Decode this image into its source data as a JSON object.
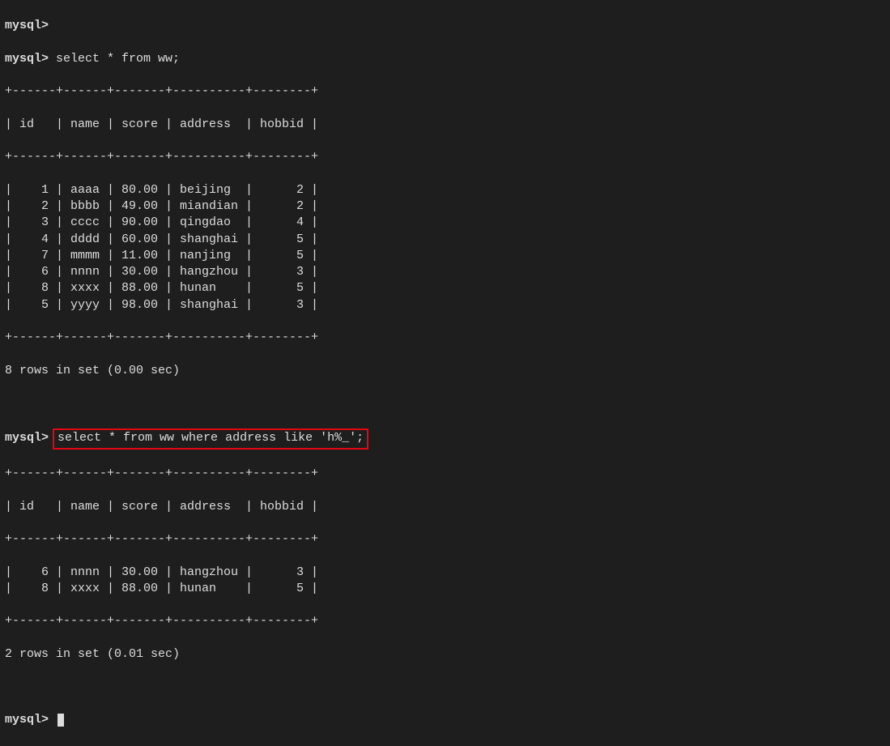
{
  "prompt": "mysql>",
  "query1": "select * from ww;",
  "query2": "select * from ww where address like 'h%_';",
  "divider1": "+------+------+-------+----------+--------+",
  "header1": "| id   | name | score | address  | hobbid |",
  "rows1": [
    "|    1 | aaaa | 80.00 | beijing  |      2 |",
    "|    2 | bbbb | 49.00 | miandian |      2 |",
    "|    3 | cccc | 90.00 | qingdao  |      4 |",
    "|    4 | dddd | 60.00 | shanghai |      5 |",
    "|    7 | mmmm | 11.00 | nanjing  |      5 |",
    "|    6 | nnnn | 30.00 | hangzhou |      3 |",
    "|    8 | xxxx | 88.00 | hunan    |      5 |",
    "|    5 | yyyy | 98.00 | shanghai |      3 |"
  ],
  "summary1": "8 rows in set (0.00 sec)",
  "divider2": "+------+------+-------+----------+--------+",
  "header2": "| id   | name | score | address  | hobbid |",
  "rows2": [
    "|    6 | nnnn | 30.00 | hangzhou |      3 |",
    "|    8 | xxxx | 88.00 | hunan    |      5 |"
  ],
  "summary2": "2 rows in set (0.01 sec)"
}
